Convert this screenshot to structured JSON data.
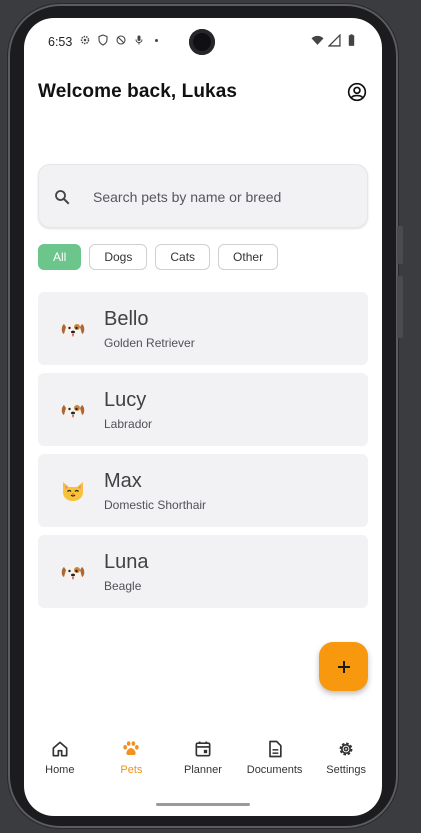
{
  "status_bar": {
    "time": "6:53",
    "left_icons": [
      "settings-icon",
      "shield-icon",
      "no-entry-icon",
      "mic-icon"
    ],
    "right_icons": [
      "wifi-icon",
      "signal-icon",
      "battery-icon"
    ]
  },
  "header": {
    "title": "Welcome back, Lukas",
    "account_icon": "account-circle-icon"
  },
  "search": {
    "placeholder": "Search pets by name or breed",
    "value": ""
  },
  "filters": {
    "chips": [
      "All",
      "Dogs",
      "Cats",
      "Other"
    ],
    "selected": "All"
  },
  "pets": [
    {
      "name": "Bello",
      "breed": "Golden Retriever",
      "icon": "dog-face-icon"
    },
    {
      "name": "Lucy",
      "breed": "Labrador",
      "icon": "dog-face-icon"
    },
    {
      "name": "Max",
      "breed": "Domestic Shorthair",
      "icon": "cat-face-icon"
    },
    {
      "name": "Luna",
      "breed": "Beagle",
      "icon": "dog-face-icon"
    }
  ],
  "fab": {
    "label": "+",
    "icon": "add-icon"
  },
  "bottom_nav": {
    "items": [
      {
        "label": "Home",
        "icon": "home-icon"
      },
      {
        "label": "Pets",
        "icon": "paw-icon"
      },
      {
        "label": "Planner",
        "icon": "calendar-icon"
      },
      {
        "label": "Documents",
        "icon": "document-icon"
      },
      {
        "label": "Settings",
        "icon": "gear-icon"
      }
    ],
    "active": "Pets"
  },
  "colors": {
    "accent_orange": "#f7980f",
    "chip_selected": "#6cc58b",
    "card_background": "#f2f2f4"
  }
}
